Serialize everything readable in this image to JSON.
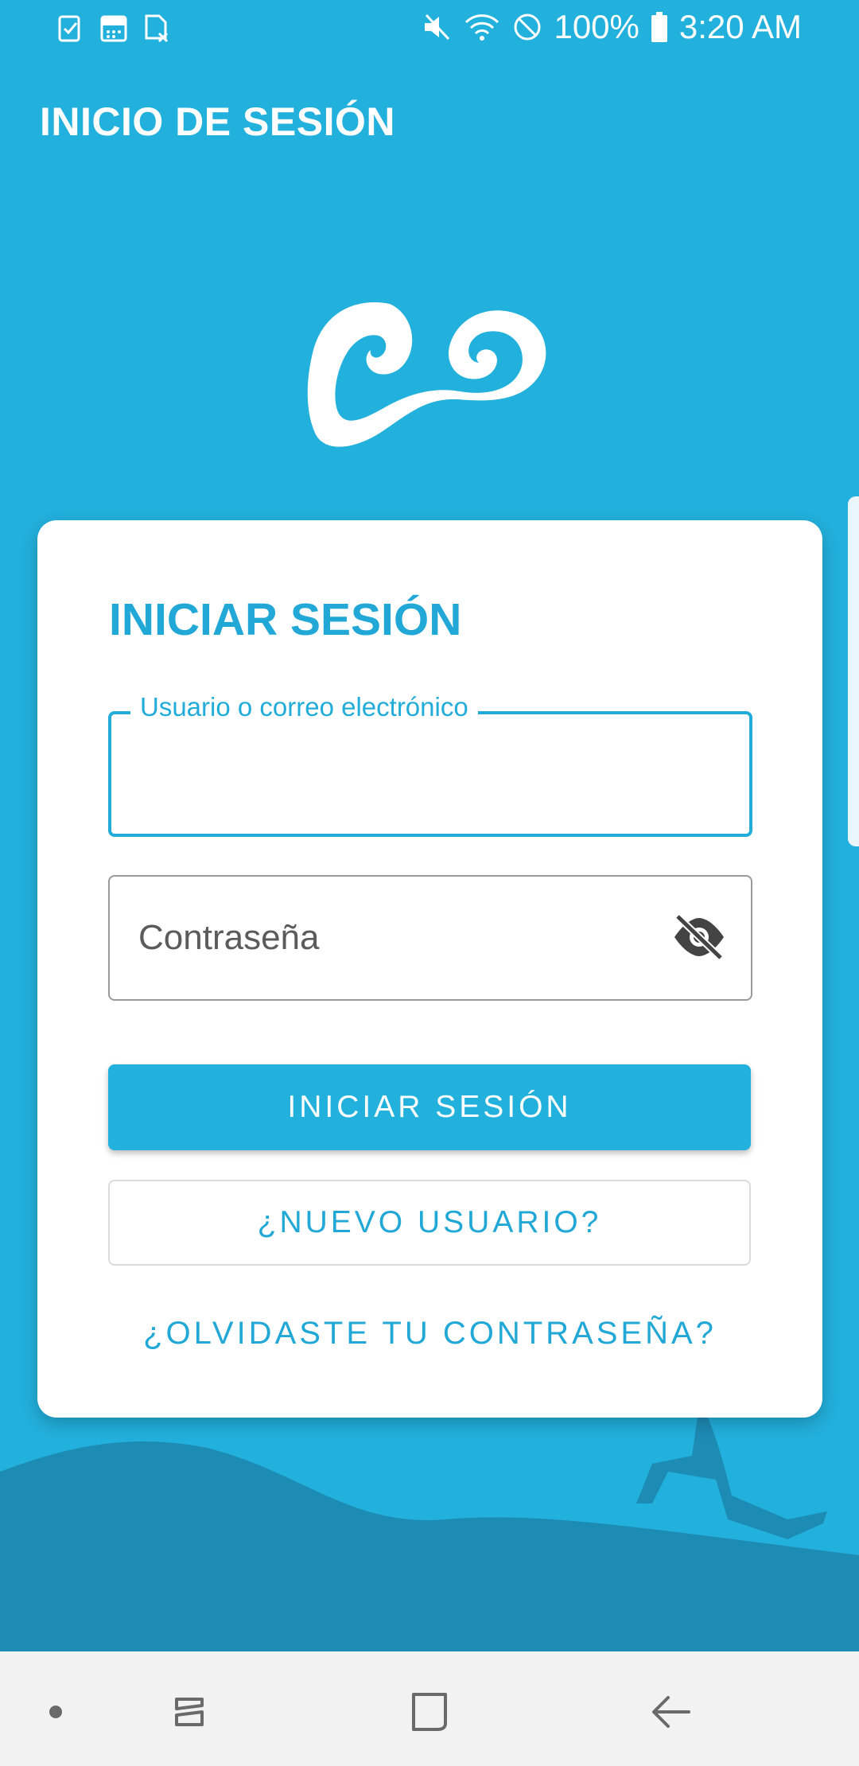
{
  "status_bar": {
    "battery": "100%",
    "time": "3:20 AM",
    "left_icons": [
      "clipboard-check-icon",
      "calendar-icon",
      "sim-off-icon"
    ],
    "right_icons": [
      "mute-icon",
      "wifi-icon",
      "do-not-disturb-icon",
      "battery-icon"
    ]
  },
  "header": {
    "title": "INICIO DE SESIÓN"
  },
  "login": {
    "title": "INICIAR SESIÓN",
    "username_label": "Usuario o correo electrónico",
    "username_value": "",
    "password_placeholder": "Contraseña",
    "password_toggle_icon": "eye-off-icon",
    "submit_label": "INICIAR SESIÓN",
    "register_label": "¿NUEVO USUARIO?",
    "forgot_label": "¿OLVIDASTE TU CONTRASEÑA?"
  },
  "nav_bar": {
    "buttons": [
      "dot-icon",
      "recent-apps-icon",
      "home-icon",
      "back-icon"
    ]
  },
  "colors": {
    "primary": "#22b0dc",
    "hill": "#1d8cb5",
    "card": "#ffffff",
    "nav_bg": "#f2f2f2"
  }
}
